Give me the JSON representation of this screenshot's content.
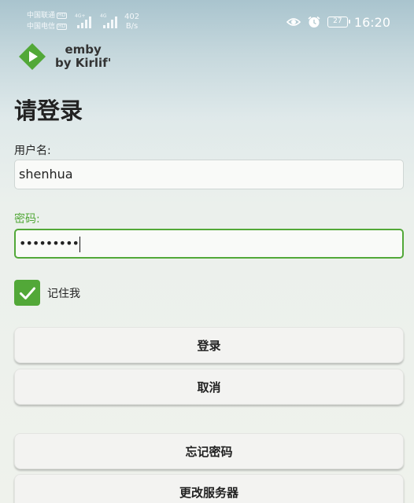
{
  "status_bar": {
    "carrier1": "中国联通",
    "carrier2": "中国电信",
    "hd": "HD",
    "network1": "4G+",
    "network2": "4G",
    "speed_value": "402",
    "speed_unit": "B/s",
    "battery": "27",
    "time": "16:20",
    "icons": [
      "eye-icon",
      "alarm-icon",
      "battery-icon",
      "signal-icon"
    ]
  },
  "logo": {
    "line1": "emby",
    "line2": "by Kirlif'",
    "brand_color": "#52a838"
  },
  "login": {
    "title": "请登录",
    "username_label": "用户名:",
    "username_value": "shenhua",
    "password_label": "密码:",
    "password_value": "•••••••••",
    "remember_label": "记住我",
    "remember_checked": true
  },
  "buttons": {
    "signin": "登录",
    "cancel": "取消",
    "forgot_password": "忘记密码",
    "change_server": "更改服务器"
  },
  "colors": {
    "accent": "#52a838",
    "text": "#222222"
  }
}
